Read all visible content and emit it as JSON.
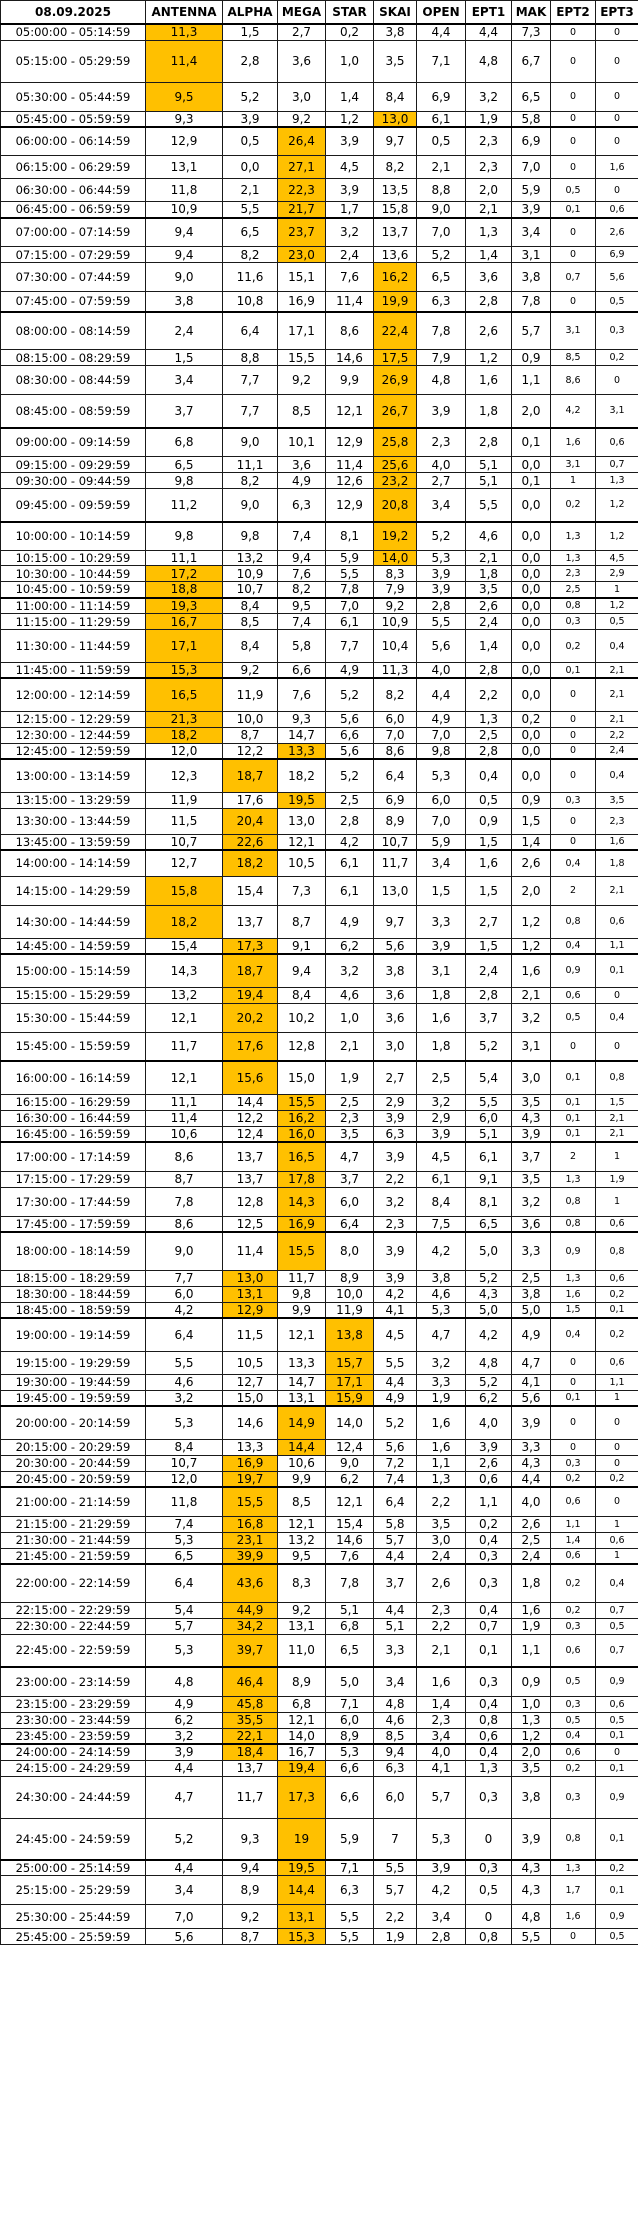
{
  "header": {
    "date": "08.09.2025",
    "channels": [
      "ANTENNA",
      "ALPHA",
      "MEGA",
      "STAR",
      "SKAI",
      "OPEN",
      "EPT1",
      "MAK",
      "EPT2",
      "EPT3"
    ]
  },
  "highlight_color": "#ffc000",
  "rows": [
    {
      "t": "05:00:00 - 05:14:59",
      "v": [
        "11,3",
        "1,5",
        "2,7",
        "0,2",
        "3,8",
        "4,4",
        "4,4",
        "7,3",
        "0",
        "0"
      ],
      "h": 0
    },
    {
      "t": "05:15:00 - 05:29:59",
      "v": [
        "11,4",
        "2,8",
        "3,6",
        "1,0",
        "3,5",
        "7,1",
        "4,8",
        "6,7",
        "0",
        "0"
      ],
      "h": 0
    },
    {
      "t": "05:30:00 - 05:44:59",
      "v": [
        "9,5",
        "5,2",
        "3,0",
        "1,4",
        "8,4",
        "6,9",
        "3,2",
        "6,5",
        "0",
        "0"
      ],
      "h": 0
    },
    {
      "t": "05:45:00 - 05:59:59",
      "v": [
        "9,3",
        "3,9",
        "9,2",
        "1,2",
        "13,0",
        "6,1",
        "1,9",
        "5,8",
        "0",
        "0"
      ],
      "h": 4
    },
    {
      "t": "06:00:00 - 06:14:59",
      "v": [
        "12,9",
        "0,5",
        "26,4",
        "3,9",
        "9,7",
        "0,5",
        "2,3",
        "6,9",
        "0",
        "0"
      ],
      "h": 2
    },
    {
      "t": "06:15:00 - 06:29:59",
      "v": [
        "13,1",
        "0,0",
        "27,1",
        "4,5",
        "8,2",
        "2,1",
        "2,3",
        "7,0",
        "0",
        "1,6"
      ],
      "h": 2
    },
    {
      "t": "06:30:00 - 06:44:59",
      "v": [
        "11,8",
        "2,1",
        "22,3",
        "3,9",
        "13,5",
        "8,8",
        "2,0",
        "5,9",
        "0,5",
        "0"
      ],
      "h": 2
    },
    {
      "t": "06:45:00 - 06:59:59",
      "v": [
        "10,9",
        "5,5",
        "21,7",
        "1,7",
        "15,8",
        "9,0",
        "2,1",
        "3,9",
        "0,1",
        "0,6"
      ],
      "h": 2
    },
    {
      "t": "07:00:00 - 07:14:59",
      "v": [
        "9,4",
        "6,5",
        "23,7",
        "3,2",
        "13,7",
        "7,0",
        "1,3",
        "3,4",
        "0",
        "2,6"
      ],
      "h": 2
    },
    {
      "t": "07:15:00 - 07:29:59",
      "v": [
        "9,4",
        "8,2",
        "23,0",
        "2,4",
        "13,6",
        "5,2",
        "1,4",
        "3,1",
        "0",
        "6,9"
      ],
      "h": 2
    },
    {
      "t": "07:30:00 - 07:44:59",
      "v": [
        "9,0",
        "11,6",
        "15,1",
        "7,6",
        "16,2",
        "6,5",
        "3,6",
        "3,8",
        "0,7",
        "5,6"
      ],
      "h": 4
    },
    {
      "t": "07:45:00 - 07:59:59",
      "v": [
        "3,8",
        "10,8",
        "16,9",
        "11,4",
        "19,9",
        "6,3",
        "2,8",
        "7,8",
        "0",
        "0,5"
      ],
      "h": 4
    },
    {
      "t": "08:00:00 - 08:14:59",
      "v": [
        "2,4",
        "6,4",
        "17,1",
        "8,6",
        "22,4",
        "7,8",
        "2,6",
        "5,7",
        "3,1",
        "0,3"
      ],
      "h": 4
    },
    {
      "t": "08:15:00 - 08:29:59",
      "v": [
        "1,5",
        "8,8",
        "15,5",
        "14,6",
        "17,5",
        "7,9",
        "1,2",
        "0,9",
        "8,5",
        "0,2"
      ],
      "h": 4
    },
    {
      "t": "08:30:00 - 08:44:59",
      "v": [
        "3,4",
        "7,7",
        "9,2",
        "9,9",
        "26,9",
        "4,8",
        "1,6",
        "1,1",
        "8,6",
        "0"
      ],
      "h": 4
    },
    {
      "t": "08:45:00 - 08:59:59",
      "v": [
        "3,7",
        "7,7",
        "8,5",
        "12,1",
        "26,7",
        "3,9",
        "1,8",
        "2,0",
        "4,2",
        "3,1"
      ],
      "h": 4
    },
    {
      "t": "09:00:00 - 09:14:59",
      "v": [
        "6,8",
        "9,0",
        "10,1",
        "12,9",
        "25,8",
        "2,3",
        "2,8",
        "0,1",
        "1,6",
        "0,6"
      ],
      "h": 4
    },
    {
      "t": "09:15:00 - 09:29:59",
      "v": [
        "6,5",
        "11,1",
        "3,6",
        "11,4",
        "25,6",
        "4,0",
        "5,1",
        "0,0",
        "3,1",
        "0,7"
      ],
      "h": 4
    },
    {
      "t": "09:30:00 - 09:44:59",
      "v": [
        "9,8",
        "8,2",
        "4,9",
        "12,6",
        "23,2",
        "2,7",
        "5,1",
        "0,1",
        "1",
        "1,3"
      ],
      "h": 4
    },
    {
      "t": "09:45:00 - 09:59:59",
      "v": [
        "11,2",
        "9,0",
        "6,3",
        "12,9",
        "20,8",
        "3,4",
        "5,5",
        "0,0",
        "0,2",
        "1,2"
      ],
      "h": 4
    },
    {
      "t": "10:00:00 - 10:14:59",
      "v": [
        "9,8",
        "9,8",
        "7,4",
        "8,1",
        "19,2",
        "5,2",
        "4,6",
        "0,0",
        "1,3",
        "1,2"
      ],
      "h": 4
    },
    {
      "t": "10:15:00 - 10:29:59",
      "v": [
        "11,1",
        "13,2",
        "9,4",
        "5,9",
        "14,0",
        "5,3",
        "2,1",
        "0,0",
        "1,3",
        "4,5"
      ],
      "h": 4
    },
    {
      "t": "10:30:00 - 10:44:59",
      "v": [
        "17,2",
        "10,9",
        "7,6",
        "5,5",
        "8,3",
        "3,9",
        "1,8",
        "0,0",
        "2,3",
        "2,9"
      ],
      "h": 0
    },
    {
      "t": "10:45:00 - 10:59:59",
      "v": [
        "18,8",
        "10,7",
        "8,2",
        "7,8",
        "7,9",
        "3,9",
        "3,5",
        "0,0",
        "2,5",
        "1"
      ],
      "h": 0
    },
    {
      "t": "11:00:00 - 11:14:59",
      "v": [
        "19,3",
        "8,4",
        "9,5",
        "7,0",
        "9,2",
        "2,8",
        "2,6",
        "0,0",
        "0,8",
        "1,2"
      ],
      "h": 0
    },
    {
      "t": "11:15:00 - 11:29:59",
      "v": [
        "16,7",
        "8,5",
        "7,4",
        "6,1",
        "10,9",
        "5,5",
        "2,4",
        "0,0",
        "0,3",
        "0,5"
      ],
      "h": 0
    },
    {
      "t": "11:30:00 - 11:44:59",
      "v": [
        "17,1",
        "8,4",
        "5,8",
        "7,7",
        "10,4",
        "5,6",
        "1,4",
        "0,0",
        "0,2",
        "0,4"
      ],
      "h": 0
    },
    {
      "t": "11:45:00 - 11:59:59",
      "v": [
        "15,3",
        "9,2",
        "6,6",
        "4,9",
        "11,3",
        "4,0",
        "2,8",
        "0,0",
        "0,1",
        "2,1"
      ],
      "h": 0
    },
    {
      "t": "12:00:00 - 12:14:59",
      "v": [
        "16,5",
        "11,9",
        "7,6",
        "5,2",
        "8,2",
        "4,4",
        "2,2",
        "0,0",
        "0",
        "2,1"
      ],
      "h": 0
    },
    {
      "t": "12:15:00 - 12:29:59",
      "v": [
        "21,3",
        "10,0",
        "9,3",
        "5,6",
        "6,0",
        "4,9",
        "1,3",
        "0,2",
        "0",
        "2,1"
      ],
      "h": 0
    },
    {
      "t": "12:30:00 - 12:44:59",
      "v": [
        "18,2",
        "8,7",
        "14,7",
        "6,6",
        "7,0",
        "7,0",
        "2,5",
        "0,0",
        "0",
        "2,2"
      ],
      "h": 0
    },
    {
      "t": "12:45:00 - 12:59:59",
      "v": [
        "12,0",
        "12,2",
        "13,3",
        "5,6",
        "8,6",
        "9,8",
        "2,8",
        "0,0",
        "0",
        "2,4"
      ],
      "h": 2
    },
    {
      "t": "13:00:00 - 13:14:59",
      "v": [
        "12,3",
        "18,7",
        "18,2",
        "5,2",
        "6,4",
        "5,3",
        "0,4",
        "0,0",
        "0",
        "0,4"
      ],
      "h": 1
    },
    {
      "t": "13:15:00 - 13:29:59",
      "v": [
        "11,9",
        "17,6",
        "19,5",
        "2,5",
        "6,9",
        "6,0",
        "0,5",
        "0,9",
        "0,3",
        "3,5"
      ],
      "h": 2
    },
    {
      "t": "13:30:00 - 13:44:59",
      "v": [
        "11,5",
        "20,4",
        "13,0",
        "2,8",
        "8,9",
        "7,0",
        "0,9",
        "1,5",
        "0",
        "2,3"
      ],
      "h": 1
    },
    {
      "t": "13:45:00 - 13:59:59",
      "v": [
        "10,7",
        "22,6",
        "12,1",
        "4,2",
        "10,7",
        "5,9",
        "1,5",
        "1,4",
        "0",
        "1,6"
      ],
      "h": 1
    },
    {
      "t": "14:00:00 - 14:14:59",
      "v": [
        "12,7",
        "18,2",
        "10,5",
        "6,1",
        "11,7",
        "3,4",
        "1,6",
        "2,6",
        "0,4",
        "1,8"
      ],
      "h": 1
    },
    {
      "t": "14:15:00 - 14:29:59",
      "v": [
        "15,8",
        "15,4",
        "7,3",
        "6,1",
        "13,0",
        "1,5",
        "1,5",
        "2,0",
        "2",
        "2,1"
      ],
      "h": 0
    },
    {
      "t": "14:30:00 - 14:44:59",
      "v": [
        "18,2",
        "13,7",
        "8,7",
        "4,9",
        "9,7",
        "3,3",
        "2,7",
        "1,2",
        "0,8",
        "0,6"
      ],
      "h": 0
    },
    {
      "t": "14:45:00 - 14:59:59",
      "v": [
        "15,4",
        "17,3",
        "9,1",
        "6,2",
        "5,6",
        "3,9",
        "1,5",
        "1,2",
        "0,4",
        "1,1"
      ],
      "h": 1
    },
    {
      "t": "15:00:00 - 15:14:59",
      "v": [
        "14,3",
        "18,7",
        "9,4",
        "3,2",
        "3,8",
        "3,1",
        "2,4",
        "1,6",
        "0,9",
        "0,1"
      ],
      "h": 1
    },
    {
      "t": "15:15:00 - 15:29:59",
      "v": [
        "13,2",
        "19,4",
        "8,4",
        "4,6",
        "3,6",
        "1,8",
        "2,8",
        "2,1",
        "0,6",
        "0"
      ],
      "h": 1
    },
    {
      "t": "15:30:00 - 15:44:59",
      "v": [
        "12,1",
        "20,2",
        "10,2",
        "1,0",
        "3,6",
        "1,6",
        "3,7",
        "3,2",
        "0,5",
        "0,4"
      ],
      "h": 1
    },
    {
      "t": "15:45:00 - 15:59:59",
      "v": [
        "11,7",
        "17,6",
        "12,8",
        "2,1",
        "3,0",
        "1,8",
        "5,2",
        "3,1",
        "0",
        "0"
      ],
      "h": 1
    },
    {
      "t": "16:00:00 - 16:14:59",
      "v": [
        "12,1",
        "15,6",
        "15,0",
        "1,9",
        "2,7",
        "2,5",
        "5,4",
        "3,0",
        "0,1",
        "0,8"
      ],
      "h": 1
    },
    {
      "t": "16:15:00 - 16:29:59",
      "v": [
        "11,1",
        "14,4",
        "15,5",
        "2,5",
        "2,9",
        "3,2",
        "5,5",
        "3,5",
        "0,1",
        "1,5"
      ],
      "h": 2
    },
    {
      "t": "16:30:00 - 16:44:59",
      "v": [
        "11,4",
        "12,2",
        "16,2",
        "2,3",
        "3,9",
        "2,9",
        "6,0",
        "4,3",
        "0,1",
        "2,1"
      ],
      "h": 2
    },
    {
      "t": "16:45:00 - 16:59:59",
      "v": [
        "10,6",
        "12,4",
        "16,0",
        "3,5",
        "6,3",
        "3,9",
        "5,1",
        "3,9",
        "0,1",
        "2,1"
      ],
      "h": 2
    },
    {
      "t": "17:00:00 - 17:14:59",
      "v": [
        "8,6",
        "13,7",
        "16,5",
        "4,7",
        "3,9",
        "4,5",
        "6,1",
        "3,7",
        "2",
        "1"
      ],
      "h": 2
    },
    {
      "t": "17:15:00 - 17:29:59",
      "v": [
        "8,7",
        "13,7",
        "17,8",
        "3,7",
        "2,2",
        "6,1",
        "9,1",
        "3,5",
        "1,3",
        "1,9"
      ],
      "h": 2
    },
    {
      "t": "17:30:00 - 17:44:59",
      "v": [
        "7,8",
        "12,8",
        "14,3",
        "6,0",
        "3,2",
        "8,4",
        "8,1",
        "3,2",
        "0,8",
        "1"
      ],
      "h": 2
    },
    {
      "t": "17:45:00 - 17:59:59",
      "v": [
        "8,6",
        "12,5",
        "16,9",
        "6,4",
        "2,3",
        "7,5",
        "6,5",
        "3,6",
        "0,8",
        "0,6"
      ],
      "h": 2
    },
    {
      "t": "18:00:00 - 18:14:59",
      "v": [
        "9,0",
        "11,4",
        "15,5",
        "8,0",
        "3,9",
        "4,2",
        "5,0",
        "3,3",
        "0,9",
        "0,8"
      ],
      "h": 2
    },
    {
      "t": "18:15:00 - 18:29:59",
      "v": [
        "7,7",
        "13,0",
        "11,7",
        "8,9",
        "3,9",
        "3,8",
        "5,2",
        "2,5",
        "1,3",
        "0,6"
      ],
      "h": 1
    },
    {
      "t": "18:30:00 - 18:44:59",
      "v": [
        "6,0",
        "13,1",
        "9,8",
        "10,0",
        "4,2",
        "4,6",
        "4,3",
        "3,8",
        "1,6",
        "0,2"
      ],
      "h": 1
    },
    {
      "t": "18:45:00 - 18:59:59",
      "v": [
        "4,2",
        "12,9",
        "9,9",
        "11,9",
        "4,1",
        "5,3",
        "5,0",
        "5,0",
        "1,5",
        "0,1"
      ],
      "h": 1
    },
    {
      "t": "19:00:00 - 19:14:59",
      "v": [
        "6,4",
        "11,5",
        "12,1",
        "13,8",
        "4,5",
        "4,7",
        "4,2",
        "4,9",
        "0,4",
        "0,2"
      ],
      "h": 3
    },
    {
      "t": "19:15:00 - 19:29:59",
      "v": [
        "5,5",
        "10,5",
        "13,3",
        "15,7",
        "5,5",
        "3,2",
        "4,8",
        "4,7",
        "0",
        "0,6"
      ],
      "h": 3
    },
    {
      "t": "19:30:00 - 19:44:59",
      "v": [
        "4,6",
        "12,7",
        "14,7",
        "17,1",
        "4,4",
        "3,3",
        "5,2",
        "4,1",
        "0",
        "1,1"
      ],
      "h": 3
    },
    {
      "t": "19:45:00 - 19:59:59",
      "v": [
        "3,2",
        "15,0",
        "13,1",
        "15,9",
        "4,9",
        "1,9",
        "6,2",
        "5,6",
        "0,1",
        "1"
      ],
      "h": 3
    },
    {
      "t": "20:00:00 - 20:14:59",
      "v": [
        "5,3",
        "14,6",
        "14,9",
        "14,0",
        "5,2",
        "1,6",
        "4,0",
        "3,9",
        "0",
        "0"
      ],
      "h": 2
    },
    {
      "t": "20:15:00 - 20:29:59",
      "v": [
        "8,4",
        "13,3",
        "14,4",
        "12,4",
        "5,6",
        "1,6",
        "3,9",
        "3,3",
        "0",
        "0"
      ],
      "h": 2
    },
    {
      "t": "20:30:00 - 20:44:59",
      "v": [
        "10,7",
        "16,9",
        "10,6",
        "9,0",
        "7,2",
        "1,1",
        "2,6",
        "4,3",
        "0,3",
        "0"
      ],
      "h": 1
    },
    {
      "t": "20:45:00 - 20:59:59",
      "v": [
        "12,0",
        "19,7",
        "9,9",
        "6,2",
        "7,4",
        "1,3",
        "0,6",
        "4,4",
        "0,2",
        "0,2"
      ],
      "h": 1
    },
    {
      "t": "21:00:00 - 21:14:59",
      "v": [
        "11,8",
        "15,5",
        "8,5",
        "12,1",
        "6,4",
        "2,2",
        "1,1",
        "4,0",
        "0,6",
        "0"
      ],
      "h": 1
    },
    {
      "t": "21:15:00 - 21:29:59",
      "v": [
        "7,4",
        "16,8",
        "12,1",
        "15,4",
        "5,8",
        "3,5",
        "0,2",
        "2,6",
        "1,1",
        "1"
      ],
      "h": 1
    },
    {
      "t": "21:30:00 - 21:44:59",
      "v": [
        "5,3",
        "23,1",
        "13,2",
        "14,6",
        "5,7",
        "3,0",
        "0,4",
        "2,5",
        "1,4",
        "0,6"
      ],
      "h": 1
    },
    {
      "t": "21:45:00 - 21:59:59",
      "v": [
        "6,5",
        "39,9",
        "9,5",
        "7,6",
        "4,4",
        "2,4",
        "0,3",
        "2,4",
        "0,6",
        "1"
      ],
      "h": 1
    },
    {
      "t": "22:00:00 - 22:14:59",
      "v": [
        "6,4",
        "43,6",
        "8,3",
        "7,8",
        "3,7",
        "2,6",
        "0,3",
        "1,8",
        "0,2",
        "0,4"
      ],
      "h": 1
    },
    {
      "t": "22:15:00 - 22:29:59",
      "v": [
        "5,4",
        "44,9",
        "9,2",
        "5,1",
        "4,4",
        "2,3",
        "0,4",
        "1,6",
        "0,2",
        "0,7"
      ],
      "h": 1
    },
    {
      "t": "22:30:00 - 22:44:59",
      "v": [
        "5,7",
        "34,2",
        "13,1",
        "6,8",
        "5,1",
        "2,2",
        "0,7",
        "1,9",
        "0,3",
        "0,5"
      ],
      "h": 1
    },
    {
      "t": "22:45:00 - 22:59:59",
      "v": [
        "5,3",
        "39,7",
        "11,0",
        "6,5",
        "3,3",
        "2,1",
        "0,1",
        "1,1",
        "0,6",
        "0,7"
      ],
      "h": 1
    },
    {
      "t": "23:00:00 - 23:14:59",
      "v": [
        "4,8",
        "46,4",
        "8,9",
        "5,0",
        "3,4",
        "1,6",
        "0,3",
        "0,9",
        "0,5",
        "0,9"
      ],
      "h": 1
    },
    {
      "t": "23:15:00 - 23:29:59",
      "v": [
        "4,9",
        "45,8",
        "6,8",
        "7,1",
        "4,8",
        "1,4",
        "0,4",
        "1,0",
        "0,3",
        "0,6"
      ],
      "h": 1
    },
    {
      "t": "23:30:00 - 23:44:59",
      "v": [
        "6,2",
        "35,5",
        "12,1",
        "6,0",
        "4,6",
        "2,3",
        "0,8",
        "1,3",
        "0,5",
        "0,5"
      ],
      "h": 1
    },
    {
      "t": "23:45:00 - 23:59:59",
      "v": [
        "3,2",
        "22,1",
        "14,0",
        "8,9",
        "8,5",
        "3,4",
        "0,6",
        "1,2",
        "0,4",
        "0,1"
      ],
      "h": 1
    },
    {
      "t": "24:00:00 - 24:14:59",
      "v": [
        "3,9",
        "18,4",
        "16,7",
        "5,3",
        "9,4",
        "4,0",
        "0,4",
        "2,0",
        "0,6",
        "0"
      ],
      "h": 1
    },
    {
      "t": "24:15:00 - 24:29:59",
      "v": [
        "4,4",
        "13,7",
        "19,4",
        "6,6",
        "6,3",
        "4,1",
        "1,3",
        "3,5",
        "0,2",
        "0,1"
      ],
      "h": 2
    },
    {
      "t": "24:30:00 - 24:44:59",
      "v": [
        "4,7",
        "11,7",
        "17,3",
        "6,6",
        "6,0",
        "5,7",
        "0,3",
        "3,8",
        "0,3",
        "0,9"
      ],
      "h": 2
    },
    {
      "t": "24:45:00 - 24:59:59",
      "v": [
        "5,2",
        "9,3",
        "19",
        "5,9",
        "7",
        "5,3",
        "0",
        "3,9",
        "0,8",
        "0,1"
      ],
      "h": 2
    },
    {
      "t": "25:00:00 - 25:14:59",
      "v": [
        "4,4",
        "9,4",
        "19,5",
        "7,1",
        "5,5",
        "3,9",
        "0,3",
        "4,3",
        "1,3",
        "0,2"
      ],
      "h": 2
    },
    {
      "t": "25:15:00 - 25:29:59",
      "v": [
        "3,4",
        "8,9",
        "14,4",
        "6,3",
        "5,7",
        "4,2",
        "0,5",
        "4,3",
        "1,7",
        "0,1"
      ],
      "h": 2
    },
    {
      "t": "25:30:00 - 25:44:59",
      "v": [
        "7,0",
        "9,2",
        "13,1",
        "5,5",
        "2,2",
        "3,4",
        "0",
        "4,8",
        "1,6",
        "0,9"
      ],
      "h": 2
    },
    {
      "t": "25:45:00 - 25:59:59",
      "v": [
        "5,6",
        "8,7",
        "15,3",
        "5,5",
        "1,9",
        "2,8",
        "0,8",
        "5,5",
        "0",
        "0,5"
      ],
      "h": 2
    }
  ]
}
